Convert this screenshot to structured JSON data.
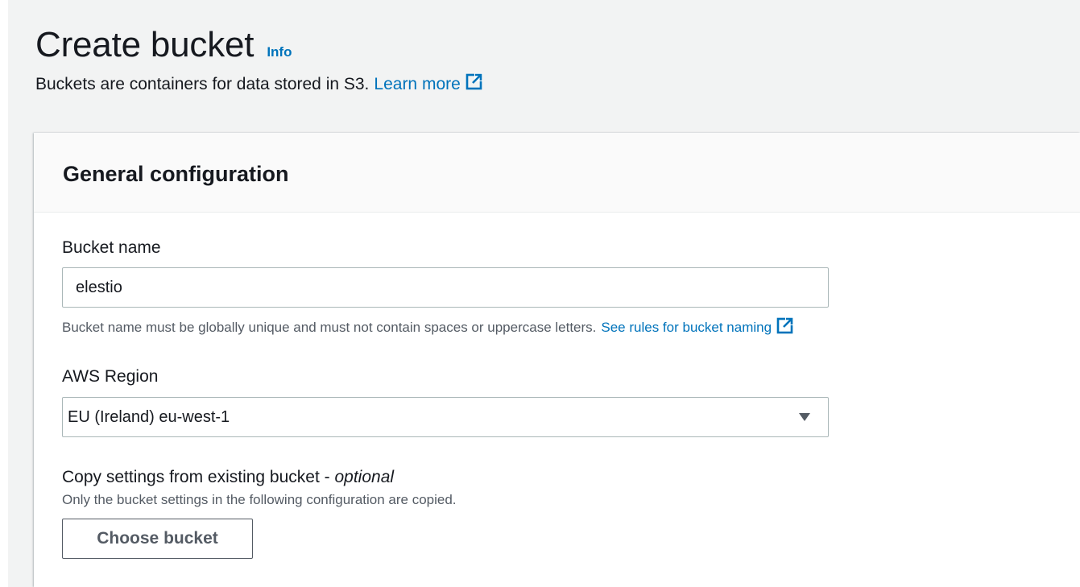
{
  "header": {
    "title": "Create bucket",
    "info_label": "Info",
    "description": "Buckets are containers for data stored in S3.",
    "learn_more_label": "Learn more",
    "icons": {
      "external": "external-link-icon"
    },
    "colors": {
      "link": "#0073bb"
    }
  },
  "general_configuration": {
    "title": "General configuration",
    "bucket_name": {
      "label": "Bucket name",
      "value": "elestio",
      "hint": "Bucket name must be globally unique and must not contain spaces or uppercase letters.",
      "rules_link_label": "See rules for bucket naming"
    },
    "region": {
      "label": "AWS Region",
      "selected": "EU (Ireland) eu-west-1",
      "icon": "caret-down-icon"
    },
    "copy_settings": {
      "label": "Copy settings from existing bucket - ",
      "optional_label": "optional",
      "description": "Only the bucket settings in the following configuration are copied.",
      "button_label": "Choose bucket"
    }
  }
}
